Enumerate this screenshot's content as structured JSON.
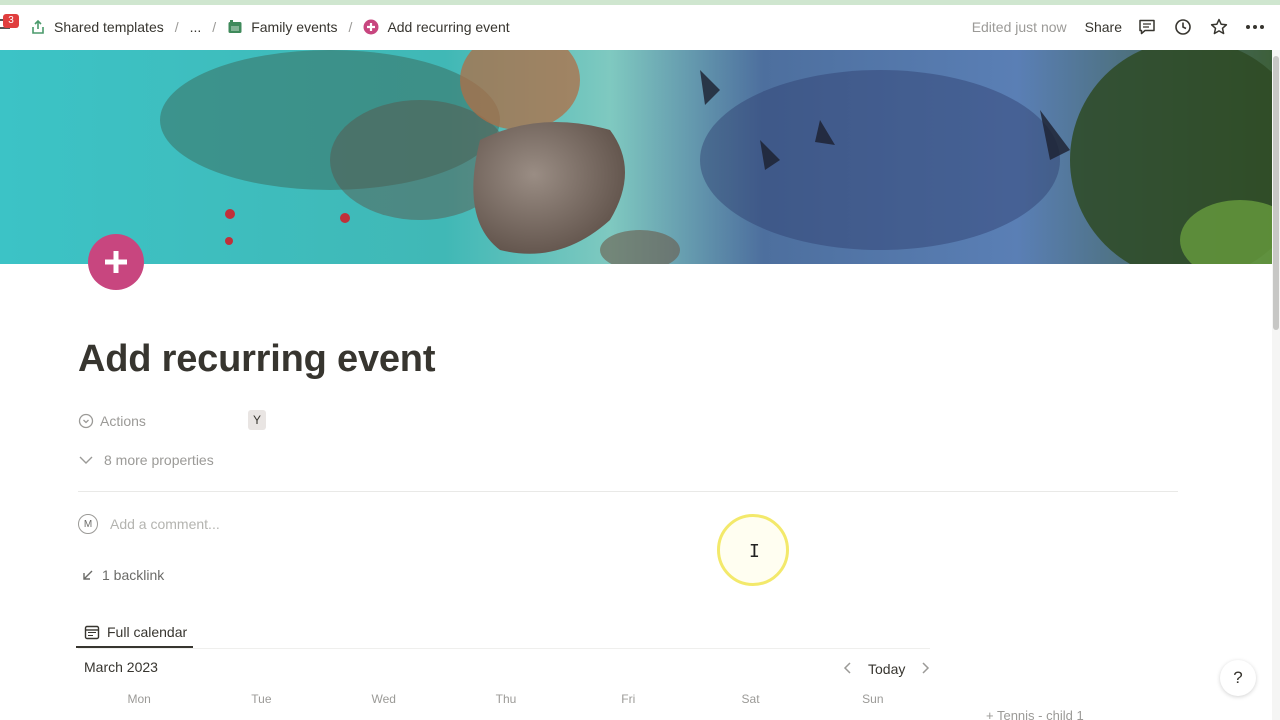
{
  "topbar": {
    "badge_count": "3",
    "breadcrumbs": [
      {
        "label": "Shared templates",
        "icon": "share-upload-icon"
      },
      {
        "label": "..."
      },
      {
        "label": "Family events",
        "icon": "calendar-folder-icon"
      },
      {
        "label": "Add recurring event",
        "icon": "plus-circle-icon"
      }
    ],
    "separator": "/",
    "edited": "Edited just now",
    "share_label": "Share",
    "icons": [
      "comment-icon",
      "history-icon",
      "star-icon",
      "more-icon"
    ]
  },
  "page": {
    "title": "Add recurring event",
    "icon": "plus-circle-icon",
    "icon_color": "#c8467f"
  },
  "properties": {
    "actions_label": "Actions",
    "actions_value": "Y",
    "more_label": "8 more properties"
  },
  "comments": {
    "avatar_initial": "M",
    "placeholder": "Add a comment..."
  },
  "backlinks": {
    "label": "1 backlink"
  },
  "calendar": {
    "view_tab": "Full calendar",
    "month": "March 2023",
    "today_label": "Today",
    "weekdays": [
      "Mon",
      "Tue",
      "Wed",
      "Thu",
      "Fri",
      "Sat",
      "Sun"
    ],
    "peek_entry": "+ Tennis - child 1"
  },
  "help_label": "?"
}
